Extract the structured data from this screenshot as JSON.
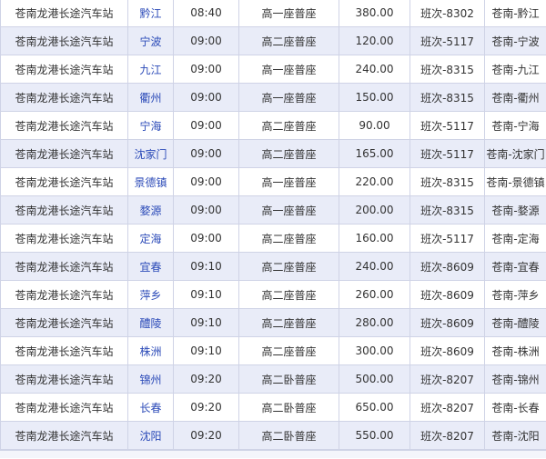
{
  "rows": [
    {
      "station": "苍南龙港长途汽车站",
      "destination": "黔江",
      "time": "08:40",
      "seat": "高一座普座",
      "price": "380.00",
      "bus": "班次-8302",
      "route": "苍南-黔江"
    },
    {
      "station": "苍南龙港长途汽车站",
      "destination": "宁波",
      "time": "09:00",
      "seat": "高二座普座",
      "price": "120.00",
      "bus": "班次-5117",
      "route": "苍南-宁波"
    },
    {
      "station": "苍南龙港长途汽车站",
      "destination": "九江",
      "time": "09:00",
      "seat": "高一座普座",
      "price": "240.00",
      "bus": "班次-8315",
      "route": "苍南-九江"
    },
    {
      "station": "苍南龙港长途汽车站",
      "destination": "衢州",
      "time": "09:00",
      "seat": "高一座普座",
      "price": "150.00",
      "bus": "班次-8315",
      "route": "苍南-衢州"
    },
    {
      "station": "苍南龙港长途汽车站",
      "destination": "宁海",
      "time": "09:00",
      "seat": "高二座普座",
      "price": "90.00",
      "bus": "班次-5117",
      "route": "苍南-宁海"
    },
    {
      "station": "苍南龙港长途汽车站",
      "destination": "沈家门",
      "time": "09:00",
      "seat": "高二座普座",
      "price": "165.00",
      "bus": "班次-5117",
      "route": "苍南-沈家门"
    },
    {
      "station": "苍南龙港长途汽车站",
      "destination": "景德镇",
      "time": "09:00",
      "seat": "高一座普座",
      "price": "220.00",
      "bus": "班次-8315",
      "route": "苍南-景德镇"
    },
    {
      "station": "苍南龙港长途汽车站",
      "destination": "婺源",
      "time": "09:00",
      "seat": "高一座普座",
      "price": "200.00",
      "bus": "班次-8315",
      "route": "苍南-婺源"
    },
    {
      "station": "苍南龙港长途汽车站",
      "destination": "定海",
      "time": "09:00",
      "seat": "高二座普座",
      "price": "160.00",
      "bus": "班次-5117",
      "route": "苍南-定海"
    },
    {
      "station": "苍南龙港长途汽车站",
      "destination": "宜春",
      "time": "09:10",
      "seat": "高二座普座",
      "price": "240.00",
      "bus": "班次-8609",
      "route": "苍南-宜春"
    },
    {
      "station": "苍南龙港长途汽车站",
      "destination": "萍乡",
      "time": "09:10",
      "seat": "高二座普座",
      "price": "260.00",
      "bus": "班次-8609",
      "route": "苍南-萍乡"
    },
    {
      "station": "苍南龙港长途汽车站",
      "destination": "醴陵",
      "time": "09:10",
      "seat": "高二座普座",
      "price": "280.00",
      "bus": "班次-8609",
      "route": "苍南-醴陵"
    },
    {
      "station": "苍南龙港长途汽车站",
      "destination": "株洲",
      "time": "09:10",
      "seat": "高二座普座",
      "price": "300.00",
      "bus": "班次-8609",
      "route": "苍南-株洲"
    },
    {
      "station": "苍南龙港长途汽车站",
      "destination": "锦州",
      "time": "09:20",
      "seat": "高二卧普座",
      "price": "500.00",
      "bus": "班次-8207",
      "route": "苍南-锦州"
    },
    {
      "station": "苍南龙港长途汽车站",
      "destination": "长春",
      "time": "09:20",
      "seat": "高二卧普座",
      "price": "650.00",
      "bus": "班次-8207",
      "route": "苍南-长春"
    },
    {
      "station": "苍南龙港长途汽车站",
      "destination": "沈阳",
      "time": "09:20",
      "seat": "高二卧普座",
      "price": "550.00",
      "bus": "班次-8207",
      "route": "苍南-沈阳"
    }
  ],
  "colors": {
    "link": "#2c4bb8",
    "row_alt": "#e9ecf8",
    "border": "#cfd3e6"
  }
}
